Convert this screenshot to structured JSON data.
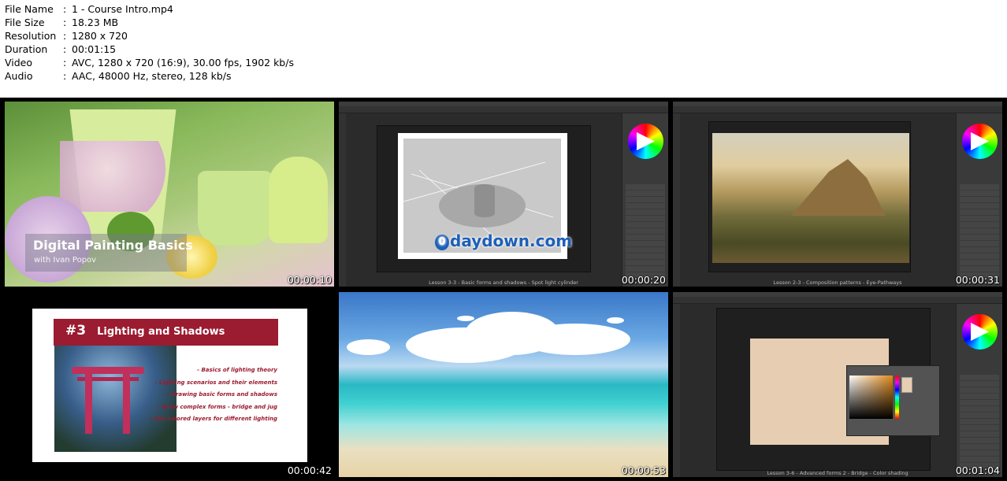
{
  "file_info": [
    {
      "key": "File Name",
      "value": "1 - Course Intro.mp4"
    },
    {
      "key": "File Size",
      "value": "18.23 MB"
    },
    {
      "key": "Resolution",
      "value": "1280 x 720"
    },
    {
      "key": "Duration",
      "value": "00:01:15"
    },
    {
      "key": "Video",
      "value": "AVC, 1280 x 720 (16:9), 30.00 fps, 1902 kb/s"
    },
    {
      "key": "Audio",
      "value": "AAC, 48000 Hz, stereo, 128 kb/s"
    }
  ],
  "separator": ":",
  "thumbnails": [
    {
      "timestamp": "00:00:10",
      "title": "Digital Painting Basics",
      "subtitle": "with Ivan Popov"
    },
    {
      "timestamp": "00:00:20",
      "caption": "Lesson 3-3 - Basic forms and shadows  -  Spot light cylinder",
      "watermark": "daydown.com",
      "watermark_mark": "0"
    },
    {
      "timestamp": "00:00:31",
      "caption": "Lesson 2-3 - Composition patterns  -  Eye-Pathways"
    },
    {
      "timestamp": "00:00:42",
      "slide_number": "#3",
      "slide_title": "Lighting and Shadows",
      "bullets": [
        "- Basics of lighting theory",
        "- Lighting scenarios and their elements",
        "- Drawing basic forms and shadows",
        "- Draw complex forms - bridge and jug",
        "- Use colored layers for different lighting"
      ]
    },
    {
      "timestamp": "00:00:53"
    },
    {
      "timestamp": "00:01:04",
      "caption": "Lesson 3-6 - Advanced forms 2 - Bridge  -  Color shading"
    }
  ]
}
